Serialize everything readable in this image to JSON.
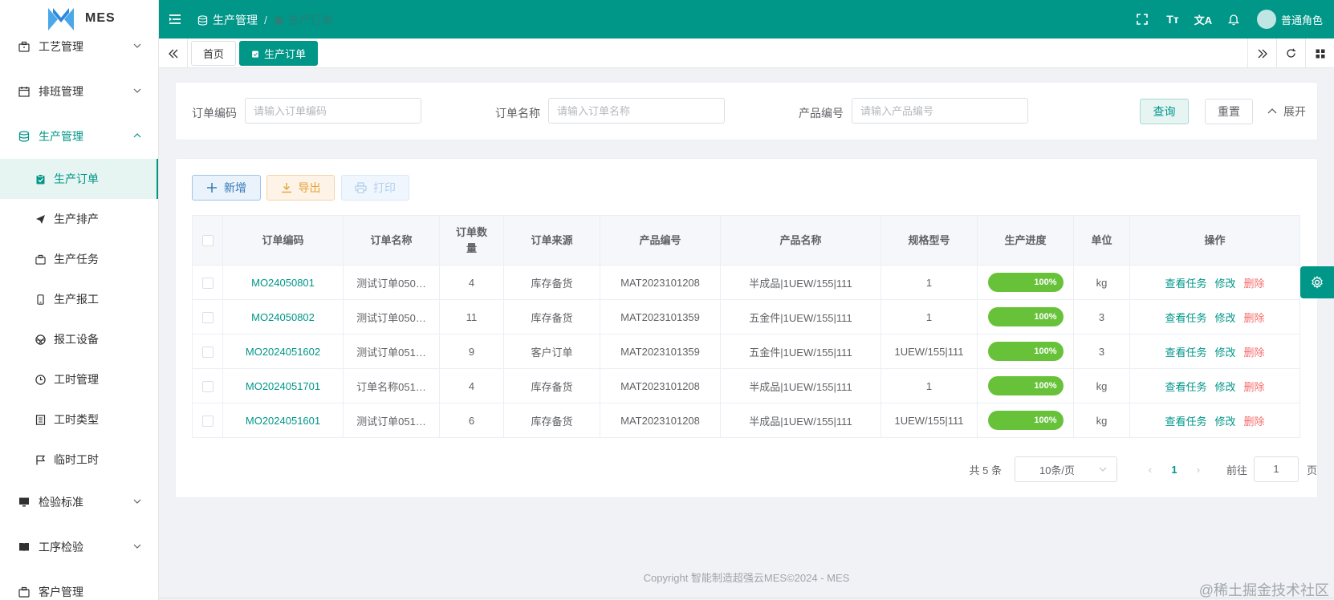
{
  "app": {
    "logo_text": "MES",
    "brand_color": "#009688"
  },
  "sidebar": {
    "items": [
      {
        "label": "工艺管理",
        "icon": "briefcase-icon"
      },
      {
        "label": "排班管理",
        "icon": "calendar-icon"
      },
      {
        "label": "生产管理",
        "icon": "database-icon"
      },
      {
        "label": "检验标准",
        "icon": "monitor-icon"
      },
      {
        "label": "工序检验",
        "icon": "book-icon"
      },
      {
        "label": "客户管理",
        "icon": "briefcase-icon"
      }
    ],
    "sub_items": [
      {
        "label": "生产订单",
        "icon": "clipboard-icon"
      },
      {
        "label": "生产排产",
        "icon": "send-icon"
      },
      {
        "label": "生产任务",
        "icon": "briefcase-icon"
      },
      {
        "label": "生产报工",
        "icon": "phone-icon"
      },
      {
        "label": "报工设备",
        "icon": "aperture-icon"
      },
      {
        "label": "工时管理",
        "icon": "clock-icon"
      },
      {
        "label": "工时类型",
        "icon": "document-icon"
      },
      {
        "label": "临时工时",
        "icon": "flag-icon"
      }
    ]
  },
  "topbar": {
    "breadcrumb": [
      "生产管理",
      "生产订单"
    ],
    "user_name": "普通角色"
  },
  "tabs": [
    "首页",
    "生产订单"
  ],
  "search": {
    "order_code_label": "订单编码",
    "order_code_placeholder": "请输入订单编码",
    "order_name_label": "订单名称",
    "order_name_placeholder": "请输入订单名称",
    "product_code_label": "产品编号",
    "product_code_placeholder": "请输入产品编号",
    "query_label": "查询",
    "reset_label": "重置",
    "expand_label": "展开"
  },
  "toolbar": {
    "add_label": "新增",
    "export_label": "导出",
    "print_label": "打印"
  },
  "table": {
    "headers": [
      "订单编码",
      "订单名称",
      "订单数量",
      "订单来源",
      "产品编号",
      "产品名称",
      "规格型号",
      "生产进度",
      "单位",
      "操作"
    ],
    "rows": [
      {
        "code": "MO24050801",
        "name": "测试订单050…",
        "qty": "4",
        "source": "库存备货",
        "product_code": "MAT2023101208",
        "product_name": "半成品|1UEW/155|111",
        "spec": "1",
        "progress": "100%",
        "unit": "kg"
      },
      {
        "code": "MO24050802",
        "name": "测试订单050…",
        "qty": "11",
        "source": "库存备货",
        "product_code": "MAT2023101359",
        "product_name": "五金件|1UEW/155|111",
        "spec": "1",
        "progress": "100%",
        "unit": "3"
      },
      {
        "code": "MO2024051602",
        "name": "测试订单051…",
        "qty": "9",
        "source": "客户订单",
        "product_code": "MAT2023101359",
        "product_name": "五金件|1UEW/155|111",
        "spec": "1UEW/155|111",
        "progress": "100%",
        "unit": "3"
      },
      {
        "code": "MO2024051701",
        "name": "订单名称051…",
        "qty": "4",
        "source": "库存备货",
        "product_code": "MAT2023101208",
        "product_name": "半成品|1UEW/155|111",
        "spec": "1",
        "progress": "100%",
        "unit": "kg"
      },
      {
        "code": "MO2024051601",
        "name": "测试订单051…",
        "qty": "6",
        "source": "库存备货",
        "product_code": "MAT2023101208",
        "product_name": "半成品|1UEW/155|111",
        "spec": "1UEW/155|111",
        "progress": "100%",
        "unit": "kg"
      }
    ],
    "actions": {
      "view": "查看任务",
      "edit": "修改",
      "delete": "删除"
    }
  },
  "pagination": {
    "total_text": "共 5 条",
    "page_size": "10条/页",
    "current_page": "1",
    "goto_label": "前往",
    "goto_value": "1",
    "page_suffix": "页"
  },
  "footer": {
    "copyright": "Copyright 智能制造超强云MES©2024 - MES"
  },
  "watermark": "@稀土掘金技术社区"
}
